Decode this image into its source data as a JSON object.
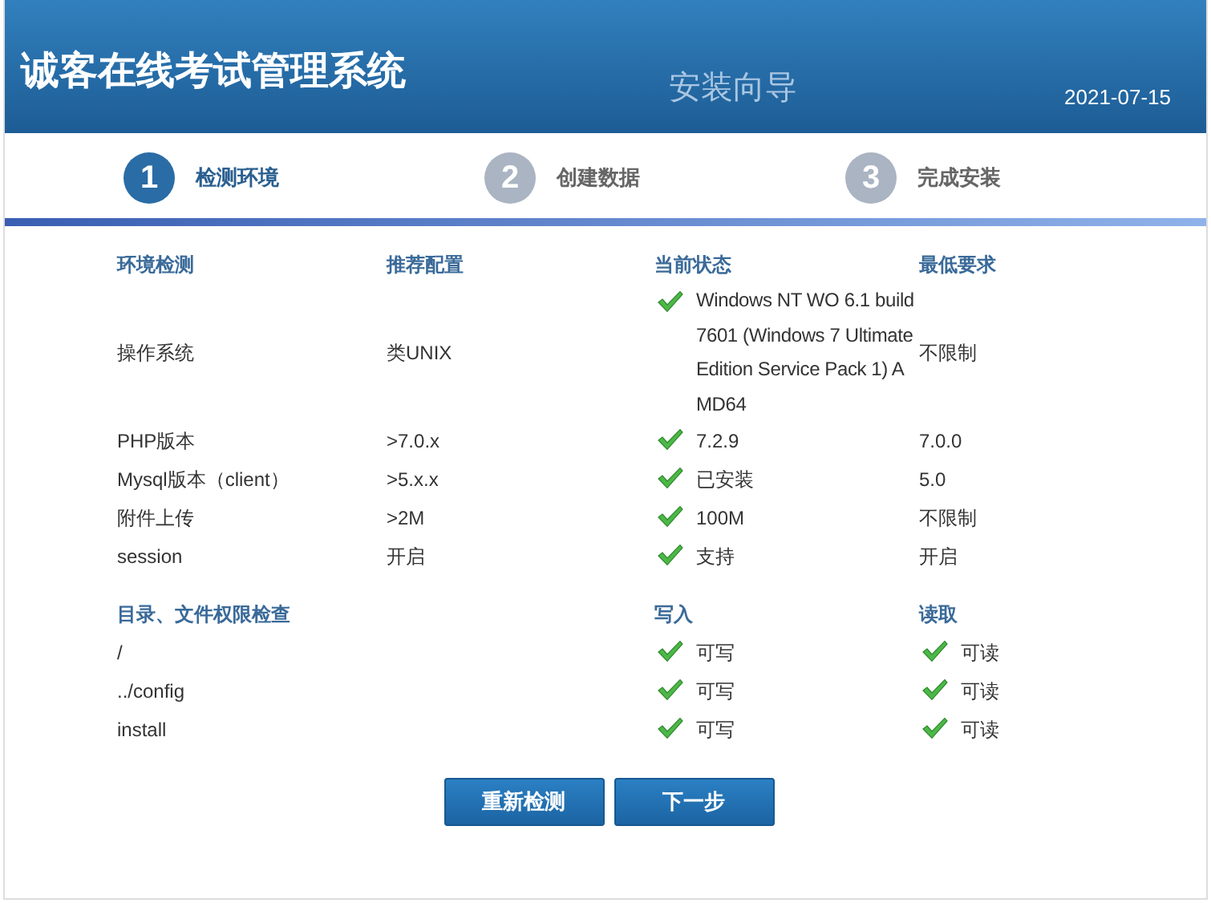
{
  "header": {
    "title": "诚客在线考试管理系统",
    "subtitle": "安装向导",
    "date": "2021-07-15"
  },
  "steps": [
    {
      "number": "1",
      "label": "检测环境",
      "selected": true
    },
    {
      "number": "2",
      "label": "创建数据",
      "selected": false
    },
    {
      "number": "3",
      "label": "完成安装",
      "selected": false
    }
  ],
  "environment": {
    "columns": [
      "环境检测",
      "推荐配置",
      "当前状态",
      "最低要求"
    ],
    "rows": [
      {
        "item": "操作系统",
        "recommended": "类UNIX",
        "current": "Windows NT WO 6.1 build 7601 (Windows 7 Ultimate Edition Service Pack 1) AMD64",
        "ok": true,
        "minimum": "不限制"
      },
      {
        "item": "PHP版本",
        "recommended": ">7.0.x",
        "current": "7.2.9",
        "ok": true,
        "minimum": "7.0.0"
      },
      {
        "item": "Mysql版本（client）",
        "recommended": ">5.x.x",
        "current": "已安装",
        "ok": true,
        "minimum": "5.0"
      },
      {
        "item": "附件上传",
        "recommended": ">2M",
        "current": "100M",
        "ok": true,
        "minimum": "不限制"
      },
      {
        "item": "session",
        "recommended": "开启",
        "current": "支持",
        "ok": true,
        "minimum": "开启"
      }
    ]
  },
  "permissions": {
    "columns": [
      "目录、文件权限检查",
      "写入",
      "读取"
    ],
    "rows": [
      {
        "path": "/",
        "write": "可写",
        "write_ok": true,
        "read": "可读",
        "read_ok": true
      },
      {
        "path": "../config",
        "write": "可写",
        "write_ok": true,
        "read": "可读",
        "read_ok": true
      },
      {
        "path": "install",
        "write": "可写",
        "write_ok": true,
        "read": "可读",
        "read_ok": true
      }
    ]
  },
  "buttons": [
    "重新检测",
    "下一步"
  ]
}
